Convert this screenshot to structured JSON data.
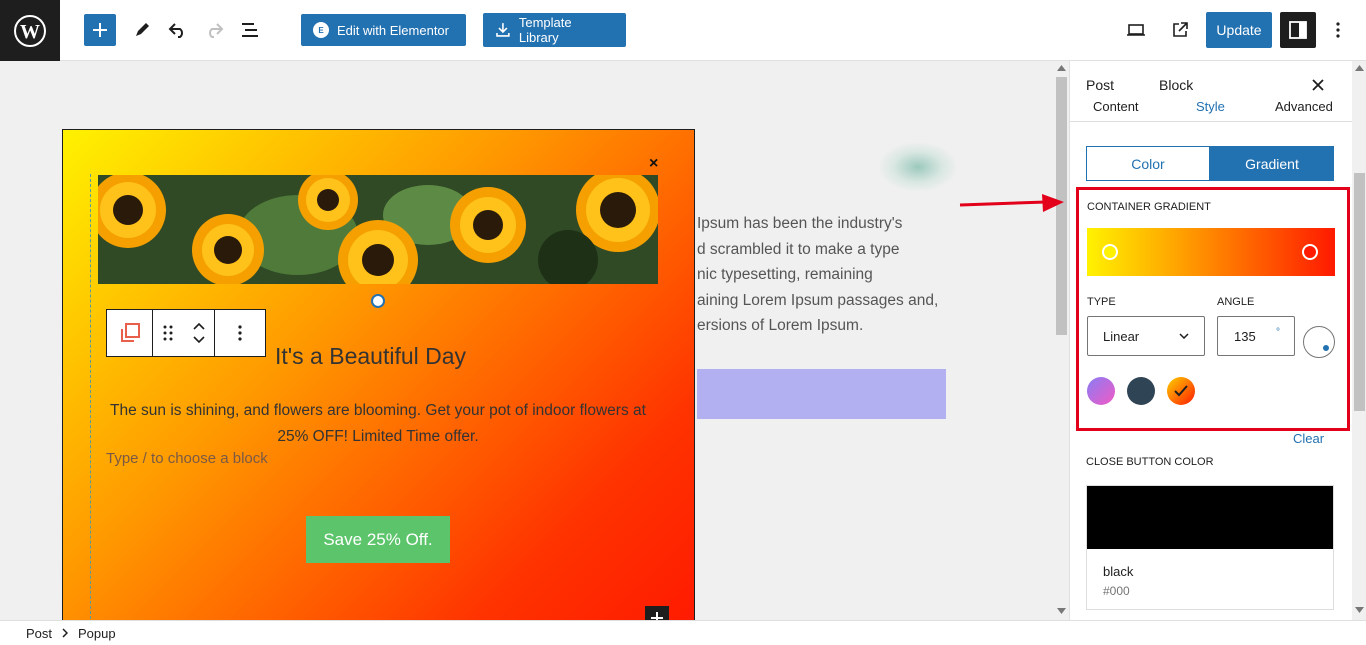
{
  "toolbar": {
    "elementor_label": "Edit with Elementor",
    "elementor_badge": "E",
    "template_library_label": "Template Library",
    "update_label": "Update"
  },
  "canvas": {
    "background_text": [
      "Ipsum has been the industry's",
      "d scrambled it to make a type",
      "nic typesetting, remaining",
      "aining Lorem Ipsum passages and,",
      "ersions of Lorem Ipsum."
    ],
    "popup": {
      "heading": "It's a Beautiful Day",
      "description": "The sun is shining, and flowers are blooming. Get your pot of indoor flowers at 25% OFF! Limited Time offer.",
      "placeholder": "Type / to choose a block",
      "button_label": "Save 25% Off.",
      "close_glyph": "×",
      "gradient_colors": [
        "#fff200",
        "#ff1a00"
      ]
    }
  },
  "panel": {
    "tabs": [
      {
        "label": "Post"
      },
      {
        "label": "Block"
      }
    ],
    "subtabs": [
      {
        "label": "Content"
      },
      {
        "label": "Style"
      },
      {
        "label": "Advanced"
      }
    ],
    "background_toggle": {
      "color_label": "Color",
      "gradient_label": "Gradient",
      "active": "Gradient"
    },
    "gradient": {
      "section_label": "Container Gradient",
      "type_label": "Type",
      "type_value": "Linear",
      "angle_label": "Angle",
      "angle_value": "135",
      "angle_unit": "°",
      "stop_colors": [
        "#fff200",
        "#ff1a00"
      ],
      "presets": [
        {
          "name": "pink-purple",
          "color": "#c470e8"
        },
        {
          "name": "dark-slate",
          "color": "#2f4454"
        },
        {
          "name": "yellow-red",
          "color": "#ff6a00"
        }
      ],
      "clear_label": "Clear"
    },
    "close_button_color": {
      "label": "Close Button Color",
      "color_name": "black",
      "color_hex": "#000"
    }
  },
  "breadcrumb": [
    {
      "label": "Post"
    },
    {
      "label": "Popup"
    }
  ],
  "colors": {
    "accent": "#2271b1",
    "annotation": "#e2001a",
    "save_green": "#5cc56b"
  }
}
